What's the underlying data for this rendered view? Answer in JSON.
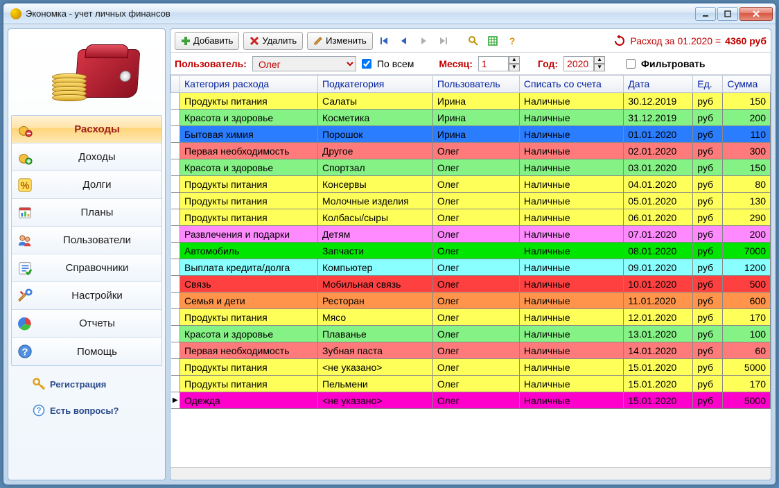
{
  "window": {
    "title": "Экономка - учет личных финансов"
  },
  "sidebar": {
    "items": [
      {
        "label": "Расходы"
      },
      {
        "label": "Доходы"
      },
      {
        "label": "Долги"
      },
      {
        "label": "Планы"
      },
      {
        "label": "Пользователи"
      },
      {
        "label": "Справочники"
      },
      {
        "label": "Настройки"
      },
      {
        "label": "Отчеты"
      },
      {
        "label": "Помощь"
      }
    ],
    "footer": {
      "register": "Регистрация",
      "questions": "Есть вопросы?"
    }
  },
  "toolbar": {
    "add": "Добавить",
    "delete": "Удалить",
    "edit": "Изменить",
    "summary_prefix": "Расход за 01.2020 = ",
    "summary_amount": "4360 руб"
  },
  "filter": {
    "user_label": "Пользователь:",
    "user_value": "Олег",
    "all_label": "По всем",
    "month_label": "Месяц:",
    "month_value": "1",
    "year_label": "Год:",
    "year_value": "2020",
    "filter_label": "Фильтровать"
  },
  "grid": {
    "headers": {
      "category": "Категория расхода",
      "subcategory": "Подкатегория",
      "user": "Пользователь",
      "account": "Списать со счета",
      "date": "Дата",
      "unit": "Ед.",
      "sum": "Сумма"
    },
    "rows": [
      {
        "color": "yellow",
        "category": "Продукты питания",
        "sub": "Салаты",
        "user": "Ирина",
        "acc": "Наличные",
        "date": "30.12.2019",
        "unit": "руб",
        "sum": "150"
      },
      {
        "color": "lgreen",
        "category": "Красота и здоровье",
        "sub": "Косметика",
        "user": "Ирина",
        "acc": "Наличные",
        "date": "31.12.2019",
        "unit": "руб",
        "sum": "200"
      },
      {
        "color": "blue",
        "category": "Бытовая химия",
        "sub": "Порошок",
        "user": "Ирина",
        "acc": "Наличные",
        "date": "01.01.2020",
        "unit": "руб",
        "sum": "110"
      },
      {
        "color": "salmon",
        "category": "Первая необходимость",
        "sub": "Другое",
        "user": "Олег",
        "acc": "Наличные",
        "date": "02.01.2020",
        "unit": "руб",
        "sum": "300"
      },
      {
        "color": "lgreen",
        "category": "Красота и здоровье",
        "sub": "Спортзал",
        "user": "Олег",
        "acc": "Наличные",
        "date": "03.01.2020",
        "unit": "руб",
        "sum": "150"
      },
      {
        "color": "yellow",
        "category": "Продукты питания",
        "sub": "Консервы",
        "user": "Олег",
        "acc": "Наличные",
        "date": "04.01.2020",
        "unit": "руб",
        "sum": "80"
      },
      {
        "color": "yellow",
        "category": "Продукты питания",
        "sub": "Молочные изделия",
        "user": "Олег",
        "acc": "Наличные",
        "date": "05.01.2020",
        "unit": "руб",
        "sum": "130"
      },
      {
        "color": "yellow",
        "category": "Продукты питания",
        "sub": "Колбасы/сыры",
        "user": "Олег",
        "acc": "Наличные",
        "date": "06.01.2020",
        "unit": "руб",
        "sum": "290"
      },
      {
        "color": "pink",
        "category": "Развлечения и подарки",
        "sub": "Детям",
        "user": "Олег",
        "acc": "Наличные",
        "date": "07.01.2020",
        "unit": "руб",
        "sum": "200"
      },
      {
        "color": "green",
        "category": "Автомобиль",
        "sub": "Запчасти",
        "user": "Олег",
        "acc": "Наличные",
        "date": "08.01.2020",
        "unit": "руб",
        "sum": "7000"
      },
      {
        "color": "cyan",
        "category": "Выплата кредита/долга",
        "sub": "Компьютер",
        "user": "Олег",
        "acc": "Наличные",
        "date": "09.01.2020",
        "unit": "руб",
        "sum": "1200"
      },
      {
        "color": "red",
        "category": "Связь",
        "sub": "Мобильная связь",
        "user": "Олег",
        "acc": "Наличные",
        "date": "10.01.2020",
        "unit": "руб",
        "sum": "500"
      },
      {
        "color": "orange",
        "category": "Семья и дети",
        "sub": "Ресторан",
        "user": "Олег",
        "acc": "Наличные",
        "date": "11.01.2020",
        "unit": "руб",
        "sum": "600"
      },
      {
        "color": "yellow",
        "category": "Продукты питания",
        "sub": "Мясо",
        "user": "Олег",
        "acc": "Наличные",
        "date": "12.01.2020",
        "unit": "руб",
        "sum": "170"
      },
      {
        "color": "lgreen",
        "category": "Красота и здоровье",
        "sub": "Плаванье",
        "user": "Олег",
        "acc": "Наличные",
        "date": "13.01.2020",
        "unit": "руб",
        "sum": "100"
      },
      {
        "color": "salmon",
        "category": "Первая необходимость",
        "sub": "Зубная паста",
        "user": "Олег",
        "acc": "Наличные",
        "date": "14.01.2020",
        "unit": "руб",
        "sum": "60"
      },
      {
        "color": "yellow",
        "category": "Продукты питания",
        "sub": "<не указано>",
        "user": "Олег",
        "acc": "Наличные",
        "date": "15.01.2020",
        "unit": "руб",
        "sum": "5000"
      },
      {
        "color": "yellow",
        "category": "Продукты питания",
        "sub": "Пельмени",
        "user": "Олег",
        "acc": "Наличные",
        "date": "15.01.2020",
        "unit": "руб",
        "sum": "170"
      },
      {
        "color": "magenta",
        "category": "Одежда",
        "sub": "<не указано>",
        "user": "Олег",
        "acc": "Наличные",
        "date": "15.01.2020",
        "unit": "руб",
        "sum": "5000",
        "current": true
      }
    ]
  }
}
